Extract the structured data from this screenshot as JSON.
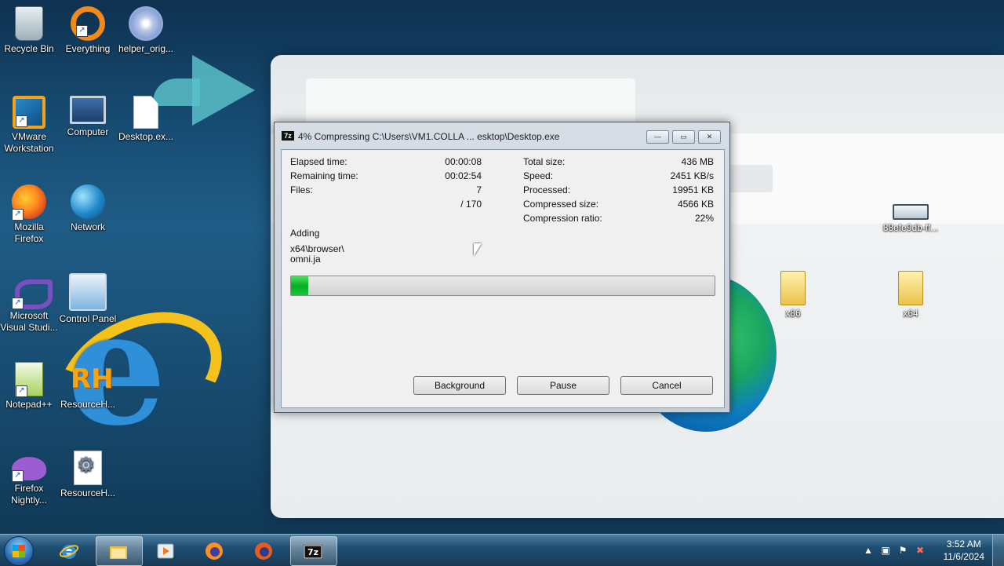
{
  "desktop": {
    "icons": [
      {
        "label": "Recycle Bin",
        "icon": "recycle-bin-icon"
      },
      {
        "label": "Everything",
        "icon": "everything-icon"
      },
      {
        "label": "helper_orig...",
        "icon": "installer-icon"
      },
      {
        "label": "VMware Workstation",
        "icon": "vmware-icon"
      },
      {
        "label": "Computer",
        "icon": "computer-icon"
      },
      {
        "label": "Desktop.ex...",
        "icon": "file-icon"
      },
      {
        "label": "Mozilla Firefox",
        "icon": "firefox-icon"
      },
      {
        "label": "Network",
        "icon": "network-icon"
      },
      {
        "label": "Microsoft Visual Studi...",
        "icon": "visual-studio-icon"
      },
      {
        "label": "Control Panel",
        "icon": "control-panel-icon"
      },
      {
        "label": "Notepad++",
        "icon": "notepadpp-icon"
      },
      {
        "label": "ResourceH...",
        "icon": "resource-hacker-icon"
      },
      {
        "label": "Firefox Nightly...",
        "icon": "firefox-nightly-icon"
      },
      {
        "label": "ResourceH...",
        "icon": "settings-file-icon"
      },
      {
        "label": "88efe9db-ff...",
        "icon": "drive-icon"
      },
      {
        "label": "x86",
        "icon": "folder-icon"
      },
      {
        "label": "x64",
        "icon": "folder-icon"
      }
    ]
  },
  "dialog": {
    "app_icon": "7z",
    "title": "4% Compressing C:\\Users\\VM1.COLLA ... esktop\\Desktop.exe",
    "buttons": {
      "minimize": "—",
      "maximize": "▭",
      "close": "✕"
    },
    "left_stats": [
      {
        "label": "Elapsed time:",
        "value": "00:00:08"
      },
      {
        "label": "Remaining time:",
        "value": "00:02:54"
      },
      {
        "label": "Files:",
        "value": "7"
      },
      {
        "label": "",
        "value": "/ 170"
      }
    ],
    "right_stats": [
      {
        "label": "Total size:",
        "value": "436 MB"
      },
      {
        "label": "Speed:",
        "value": "2451 KB/s"
      },
      {
        "label": "Processed:",
        "value": "19951 KB"
      },
      {
        "label": "Compressed size:",
        "value": "4566 KB"
      },
      {
        "label": "Compression ratio:",
        "value": "22%"
      }
    ],
    "operation": "Adding",
    "current_file_line1": "x64\\browser\\",
    "current_file_line2": "omni.ja",
    "progress_percent": 4,
    "actions": {
      "background": "Background",
      "pause": "Pause",
      "cancel": "Cancel"
    }
  },
  "taskbar": {
    "clock_time": "3:52 AM",
    "clock_date": "11/6/2024",
    "items": [
      "internet-explorer-icon",
      "file-explorer-icon",
      "media-player-icon",
      "firefox-icon",
      "firefox-icon",
      "7zip-icon"
    ],
    "active_item": "7zip-icon",
    "tray": {
      "arrow": "▲"
    }
  }
}
